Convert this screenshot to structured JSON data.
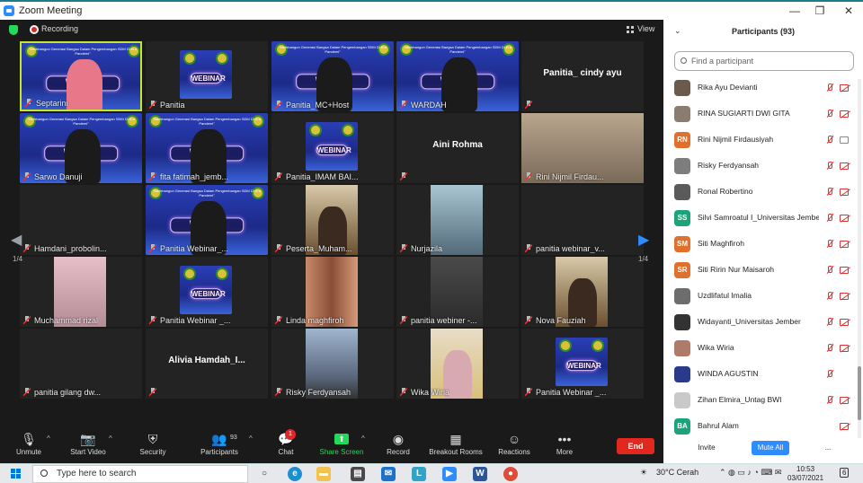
{
  "window": {
    "title": "Zoom Meeting",
    "minimize": "—",
    "restore": "❐",
    "close": "✕"
  },
  "meeting": {
    "recording_label": "Recording",
    "view_label": "View",
    "page_indicator_left": "1/4",
    "page_indicator_right": "1/4",
    "tiles": [
      {
        "name": "Septarini"
      },
      {
        "name": "Panitia"
      },
      {
        "name": "Panitia_MC+Host"
      },
      {
        "name": "WARDAH"
      },
      {
        "name": "",
        "center": "Panitia_ cindy ayu"
      },
      {
        "name": "Sarwo Danuji"
      },
      {
        "name": "fita fatimah_jemb..."
      },
      {
        "name": "Panitia_IMAM BAI..."
      },
      {
        "name": "",
        "center": "Aini Rohma"
      },
      {
        "name": "Rini Nijmil Firdau..."
      },
      {
        "name": "Hamdani_probolin..."
      },
      {
        "name": "Panitia Webinar_..."
      },
      {
        "name": "Peserta_Muham..."
      },
      {
        "name": "Nurjazila"
      },
      {
        "name": "panitia webinar_v..."
      },
      {
        "name": "Muchammad rizal"
      },
      {
        "name": "Panitia Webinar _..."
      },
      {
        "name": "Linda maghfiroh"
      },
      {
        "name": "panitia webiner -..."
      },
      {
        "name": "Nova Fauziah"
      },
      {
        "name": "panitia gilang dw..."
      },
      {
        "name": "",
        "center": "Alivia  Hamdah_I..."
      },
      {
        "name": "Risky Ferdyansah"
      },
      {
        "name": "Wika Wiria"
      },
      {
        "name": "Panitia Webinar _..."
      }
    ],
    "banner": {
      "caption": "\"Membangun Generasi Bangsa Dalam Pengembangan SDM Di Era Pandemi\"",
      "webinar": "WEBINAR",
      "webinar_cut": "WEBINAR"
    }
  },
  "toolbar": {
    "unmute": "Unmute",
    "start_video": "Start Video",
    "security": "Security",
    "participants": "Participants",
    "participants_count": "93",
    "chat": "Chat",
    "chat_badge": "1",
    "share_screen": "Share Screen",
    "record": "Record",
    "breakout_rooms": "Breakout Rooms",
    "reactions": "Reactions",
    "more": "More",
    "end": "End",
    "caret": "^"
  },
  "panel": {
    "title": "Participants (93)",
    "search_placeholder": "Find a participant",
    "participants": [
      {
        "name": "Rika Ayu Devianti",
        "initials": "",
        "avatar_color": "#6b5a4e",
        "video": "off",
        "mic": "off"
      },
      {
        "name": "RINA SUGIARTI DWI GITA",
        "initials": "",
        "avatar_color": "#8a7c70",
        "video": "off",
        "mic": "off"
      },
      {
        "name": "Rini Nijmil Firdausiyah",
        "initials": "RN",
        "avatar_color": "#e0702d",
        "video": "on",
        "mic": "off"
      },
      {
        "name": "Risky Ferdyansah",
        "initials": "",
        "avatar_color": "#7d7d7d",
        "video": "off",
        "mic": "off"
      },
      {
        "name": "Ronal Robertino",
        "initials": "",
        "avatar_color": "#5a5a5a",
        "video": "off",
        "mic": "off"
      },
      {
        "name": "Silvi Samroatul I_Universitas Jember",
        "initials": "SS",
        "avatar_color": "#1da37a",
        "video": "off",
        "mic": "off"
      },
      {
        "name": "Siti Maghfiroh",
        "initials": "SM",
        "avatar_color": "#e0702d",
        "video": "off",
        "mic": "off"
      },
      {
        "name": "Siti Ririn Nur Maisaroh",
        "initials": "SR",
        "avatar_color": "#e0702d",
        "video": "off",
        "mic": "off"
      },
      {
        "name": "Uzdlifatul Imalia",
        "initials": "",
        "avatar_color": "#6d6d6d",
        "video": "off",
        "mic": "off"
      },
      {
        "name": "Widayanti_Universitas Jember",
        "initials": "",
        "avatar_color": "#333333",
        "video": "off",
        "mic": "off"
      },
      {
        "name": "Wika Wiria",
        "initials": "",
        "avatar_color": "#b07a6a",
        "video": "off",
        "mic": "off"
      },
      {
        "name": "WINDA AGUSTIN",
        "initials": "",
        "avatar_color": "#2a3a8a",
        "video": "none",
        "mic": "off"
      },
      {
        "name": "Zihan Elmira_Untag BWI",
        "initials": "",
        "avatar_color": "#c9c9c9",
        "video": "off",
        "mic": "off"
      },
      {
        "name": "Bahrul Alam",
        "initials": "BA",
        "avatar_color": "#1da37a",
        "video": "off",
        "mic": "none"
      }
    ],
    "invite": "Invite",
    "mute_all": "Mute All",
    "more": "..."
  },
  "taskbar": {
    "search_placeholder": "Type here to search",
    "weather": "30°C  Cerah",
    "time": "10:53",
    "date": "03/07/2021",
    "notifications": "6"
  },
  "colors": {
    "accent": "#2d8cff",
    "end_red": "#e0281e",
    "speaker_border": "#c6e62b",
    "share_green": "#23d959"
  }
}
